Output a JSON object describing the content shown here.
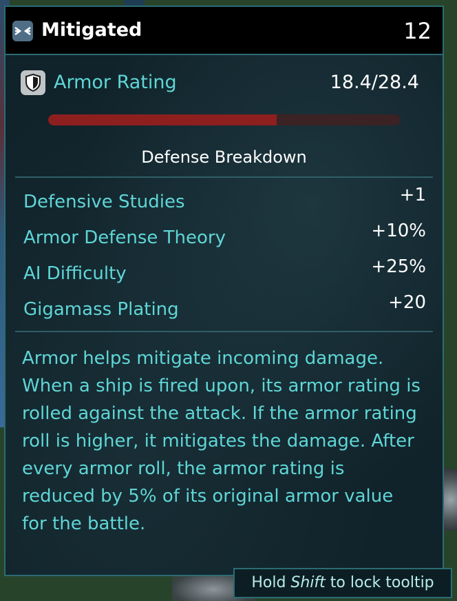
{
  "header": {
    "icon": "mitigated-arrows-icon",
    "title": "Mitigated",
    "value": "12"
  },
  "armor": {
    "icon": "shield-icon",
    "label": "Armor Rating",
    "value": "18.4/28.4",
    "fill_fraction": 0.648
  },
  "breakdown": {
    "title": "Defense Breakdown",
    "items": [
      {
        "label": "Defensive Studies",
        "value": "+1"
      },
      {
        "label": "Armor Defense Theory",
        "value": "+10%"
      },
      {
        "label": "AI Difficulty",
        "value": "+25%"
      },
      {
        "label": "Gigamass Plating",
        "value": "+20"
      }
    ]
  },
  "description": "Armor helps mitigate incoming damage. When a ship is fired upon, its armor rating is rolled against the attack. If the armor rating roll is higher, it mitigates the damage. After every armor roll, the armor rating is reduced by 5% of its original armor value for the battle.",
  "hint": {
    "prefix": "Hold ",
    "key": "Shift",
    "suffix": " to lock tooltip"
  },
  "colors": {
    "accent": "#5fd6d6",
    "border": "#2c6c74",
    "bar_fill": "#8d1f1f",
    "bar_track": "#3b2224"
  }
}
